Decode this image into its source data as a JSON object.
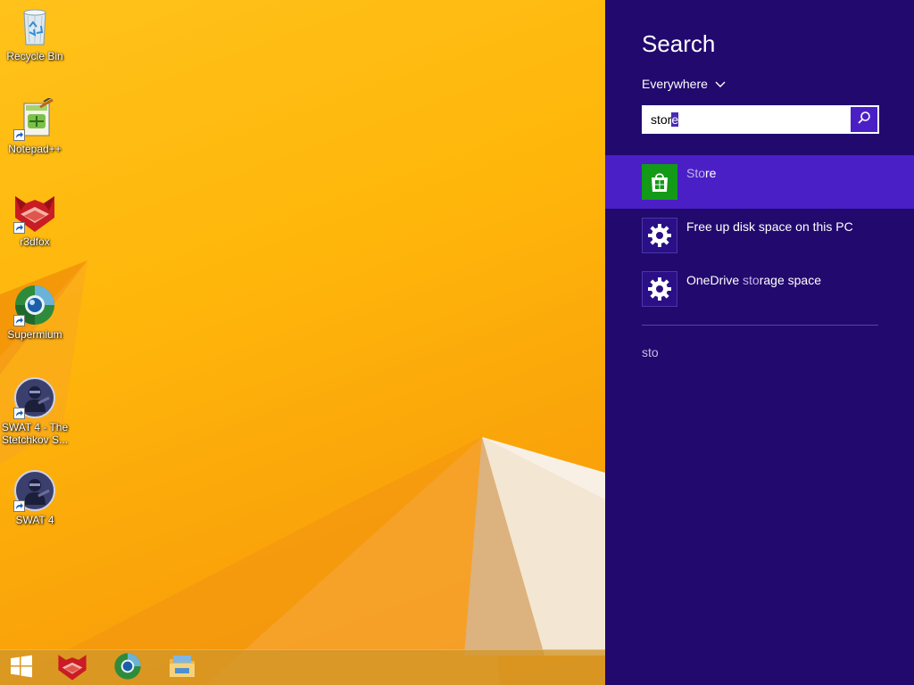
{
  "desktop": {
    "icons": [
      {
        "label": "Recycle Bin",
        "icon": "recycle-bin-icon"
      },
      {
        "label": "Notepad++",
        "icon": "notepadpp-icon"
      },
      {
        "label": "r3dfox",
        "icon": "r3dfox-icon"
      },
      {
        "label": "Supermium",
        "icon": "supermium-icon"
      },
      {
        "label": "SWAT 4 - The Stetchkov S...",
        "icon": "swat4-icon"
      },
      {
        "label": "SWAT 4",
        "icon": "swat4-icon"
      }
    ]
  },
  "taskbar": {
    "items": [
      {
        "icon": "windows-start-icon"
      },
      {
        "icon": "r3dfox-icon"
      },
      {
        "icon": "supermium-icon"
      },
      {
        "icon": "file-explorer-icon"
      }
    ]
  },
  "search": {
    "title": "Search",
    "scope": "Everywhere",
    "query_plain": "stor",
    "query_selected": "e",
    "results": [
      {
        "match": "Sto",
        "rest": "re",
        "icon": "store-icon",
        "selected": true
      },
      {
        "prefix": "Free up disk space on this PC",
        "icon": "settings-gear-icon",
        "selected": false
      },
      {
        "prefix": "OneDrive ",
        "match": "sto",
        "rest": "rage space",
        "icon": "settings-gear-icon",
        "selected": false
      }
    ],
    "suggestion": "sto"
  },
  "colors": {
    "charm_bg": "#22096e",
    "accent": "#4b1fc6",
    "store_green": "#139a18"
  }
}
